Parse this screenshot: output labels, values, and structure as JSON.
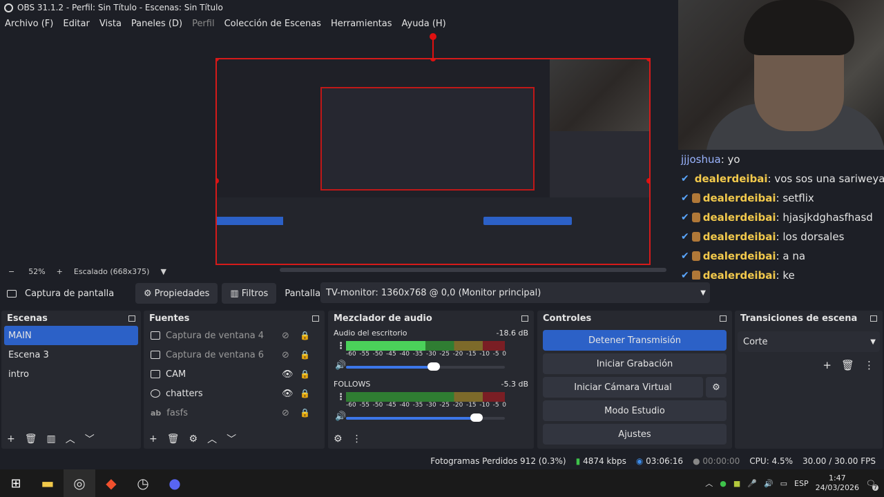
{
  "window": {
    "title": "OBS 31.1.2 - Perfil: Sin Título - Escenas: Sin Título"
  },
  "menu": {
    "items": [
      "Archivo (F)",
      "Editar",
      "Vista",
      "Paneles (D)",
      "Perfil",
      "Colección de Escenas",
      "Herramientas",
      "Ayuda (H)"
    ]
  },
  "chat": {
    "first_user": "jjjoshua",
    "first_msg": ": yo",
    "lines": [
      {
        "user": "dealerdeibai",
        "msg": ": vos sos una sariweya"
      },
      {
        "user": "dealerdeibai",
        "msg": ": setflix"
      },
      {
        "user": "dealerdeibai",
        "msg": ": hjasjkdghasfhasd"
      },
      {
        "user": "dealerdeibai",
        "msg": ": los dorsales"
      },
      {
        "user": "dealerdeibai",
        "msg": ": a na"
      },
      {
        "user": "dealerdeibai",
        "msg": ": ke"
      }
    ]
  },
  "zoom": {
    "minus": "−",
    "percent": "52%",
    "plus": "+",
    "scaling": "Escalado (668x375)"
  },
  "sourcebar": {
    "source_name": "Captura de pantalla",
    "properties": "Propiedades",
    "filters": "Filtros",
    "display_label": "Pantalla",
    "display_value": "TV-monitor: 1360x768 @ 0,0 (Monitor principal)"
  },
  "scenes": {
    "title": "Escenas",
    "items": [
      "MAIN",
      "Escena 3",
      "intro"
    ]
  },
  "sources": {
    "title": "Fuentes",
    "items": [
      "Captura de ventana 4",
      "Captura de ventana 6",
      "CAM",
      "chatters",
      "fasfs"
    ]
  },
  "mixer": {
    "title": "Mezclador de audio",
    "ticks": [
      "-60",
      "-55",
      "-50",
      "-45",
      "-40",
      "-35",
      "-30",
      "-25",
      "-20",
      "-15",
      "-10",
      "-5",
      "0"
    ],
    "tracks": [
      {
        "name": "Audio del escritorio",
        "db": "-18.6 dB",
        "level": 0.5,
        "volume": 0.55
      },
      {
        "name": "FOLLOWS",
        "db": "-5.3 dB",
        "level": 0.0,
        "volume": 0.82
      }
    ]
  },
  "controls": {
    "title": "Controles",
    "stop_stream": "Detener Transmisión",
    "start_rec": "Iniciar Grabación",
    "virtual_cam": "Iniciar Cámara Virtual",
    "studio": "Modo Estudio",
    "settings": "Ajustes"
  },
  "transitions": {
    "title": "Transiciones de escena",
    "selected": "Corte"
  },
  "status": {
    "dropped": "Fotogramas Perdidos 912 (0.3%)",
    "bitrate": "4874 kbps",
    "stream_time": "03:06:16",
    "rec_time": "00:00:00",
    "cpu": "CPU: 4.5%",
    "fps": "30.00 / 30.00 FPS"
  },
  "taskbar": {
    "lang": "ESP",
    "time": "1:47",
    "date": "24/03/2026",
    "notif_count": "7"
  },
  "colors": {
    "accent": "#2c61c7",
    "selection": "#d61a1a",
    "chat_user": "#f2c94c"
  }
}
